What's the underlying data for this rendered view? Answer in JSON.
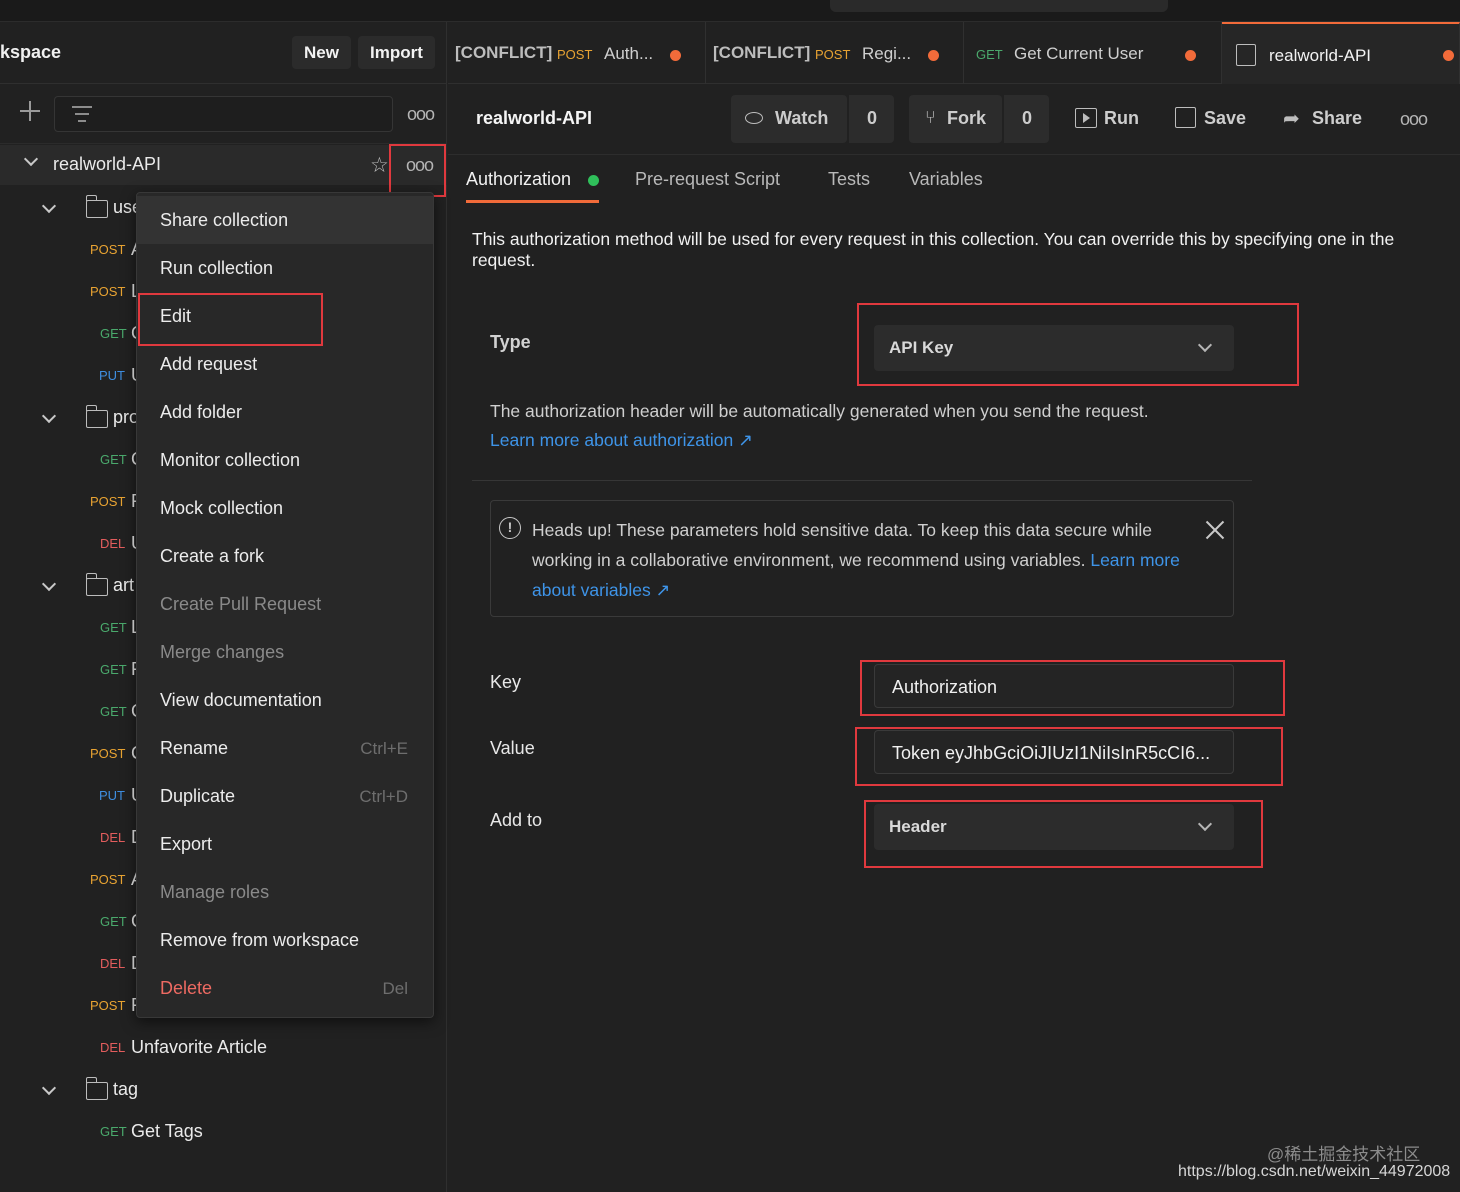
{
  "workspace": {
    "title": "kspace",
    "new_label": "New",
    "import_label": "Import"
  },
  "sidebar": {
    "collection_name": "realworld-API",
    "folders": [
      {
        "name": "use",
        "requests": [
          {
            "method": "POST",
            "name": "A"
          },
          {
            "method": "POST",
            "name": "L"
          },
          {
            "method": "GET",
            "name": "G"
          },
          {
            "method": "PUT",
            "name": "U"
          }
        ]
      },
      {
        "name": "pro",
        "requests": [
          {
            "method": "GET",
            "name": "G"
          },
          {
            "method": "POST",
            "name": "F"
          },
          {
            "method": "DEL",
            "name": "U"
          }
        ]
      },
      {
        "name": "art",
        "requests": [
          {
            "method": "GET",
            "name": "L"
          },
          {
            "method": "GET",
            "name": "F"
          },
          {
            "method": "GET",
            "name": "G"
          },
          {
            "method": "POST",
            "name": "C"
          },
          {
            "method": "PUT",
            "name": "U"
          },
          {
            "method": "DEL",
            "name": "D"
          },
          {
            "method": "POST",
            "name": "A"
          },
          {
            "method": "GET",
            "name": "G"
          },
          {
            "method": "DEL",
            "name": "D"
          },
          {
            "method": "POST",
            "name": "F"
          },
          {
            "method": "DEL",
            "name": "Unfavorite Article"
          }
        ]
      },
      {
        "name": "tag",
        "requests": [
          {
            "method": "GET",
            "name": "Get Tags"
          }
        ]
      }
    ]
  },
  "context_menu": [
    {
      "label": "Share collection",
      "shortcut": ""
    },
    {
      "label": "Run collection",
      "shortcut": ""
    },
    {
      "label": "Edit",
      "shortcut": ""
    },
    {
      "label": "Add request",
      "shortcut": ""
    },
    {
      "label": "Add folder",
      "shortcut": ""
    },
    {
      "label": "Monitor collection",
      "shortcut": ""
    },
    {
      "label": "Mock collection",
      "shortcut": ""
    },
    {
      "label": "Create a fork",
      "shortcut": ""
    },
    {
      "label": "Create Pull Request",
      "shortcut": ""
    },
    {
      "label": "Merge changes",
      "shortcut": ""
    },
    {
      "label": "View documentation",
      "shortcut": ""
    },
    {
      "label": "Rename",
      "shortcut": "Ctrl+E"
    },
    {
      "label": "Duplicate",
      "shortcut": "Ctrl+D"
    },
    {
      "label": "Export",
      "shortcut": ""
    },
    {
      "label": "Manage roles",
      "shortcut": ""
    },
    {
      "label": "Remove from workspace",
      "shortcut": ""
    },
    {
      "label": "Delete",
      "shortcut": "Del"
    }
  ],
  "tabs": [
    {
      "conflict": "[CONFLICT]",
      "method": "POST",
      "title": "Auth..."
    },
    {
      "conflict": "[CONFLICT]",
      "method": "POST",
      "title": "Regi..."
    },
    {
      "conflict": "",
      "method": "GET",
      "title": "Get Current User"
    },
    {
      "conflict": "",
      "method": "",
      "title": "realworld-API"
    }
  ],
  "collection_header": {
    "title": "realworld-API",
    "watch_label": "Watch",
    "watch_count": "0",
    "fork_label": "Fork",
    "fork_count": "0",
    "run_label": "Run",
    "save_label": "Save",
    "share_label": "Share"
  },
  "subtabs": [
    "Authorization",
    "Pre-request Script",
    "Tests",
    "Variables"
  ],
  "auth": {
    "description": "This authorization method will be used for every request in this collection. You can override this by specifying one in the request.",
    "type_label": "Type",
    "type_value": "API Key",
    "info_text": "The authorization header will be automatically generated when you send the request.",
    "info_link": "Learn more about authorization ↗",
    "warning_text": "Heads up! These parameters hold sensitive data. To keep this data secure while working in a collaborative environment, we recommend using variables.",
    "warning_link": "Learn more about variables ↗",
    "key_label": "Key",
    "key_value": "Authorization",
    "value_label": "Value",
    "value_value": "Token eyJhbGciOiJIUzI1NiIsInR5cCI6...",
    "addto_label": "Add to",
    "addto_value": "Header"
  },
  "watermark": {
    "line1": "@稀土掘金技术社区",
    "line2": "https://blog.csdn.net/weixin_44972008"
  },
  "colors": {
    "accent": "#f26b3a",
    "highlight": "#e0393e",
    "link": "#3e94e8",
    "success": "#2fbf5a"
  }
}
